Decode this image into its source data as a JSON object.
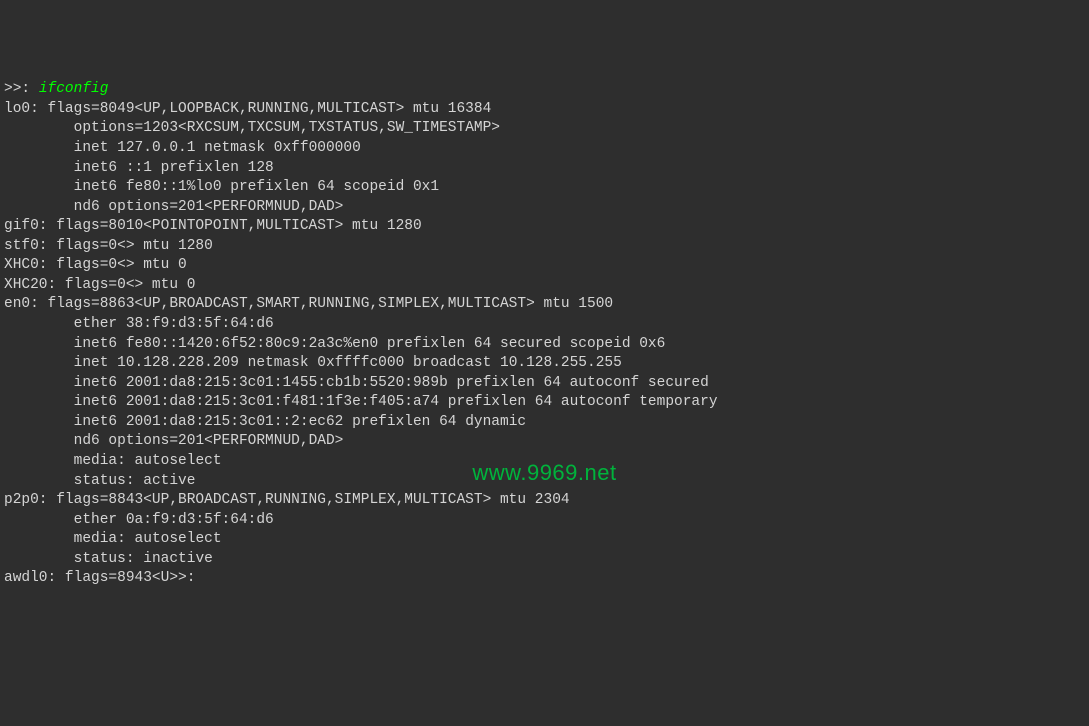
{
  "prompt": ">>: ",
  "command": "ifconfig",
  "lines": [
    "lo0: flags=8049<UP,LOOPBACK,RUNNING,MULTICAST> mtu 16384",
    "\toptions=1203<RXCSUM,TXCSUM,TXSTATUS,SW_TIMESTAMP>",
    "\tinet 127.0.0.1 netmask 0xff000000",
    "\tinet6 ::1 prefixlen 128",
    "\tinet6 fe80::1%lo0 prefixlen 64 scopeid 0x1",
    "\tnd6 options=201<PERFORMNUD,DAD>",
    "gif0: flags=8010<POINTOPOINT,MULTICAST> mtu 1280",
    "stf0: flags=0<> mtu 1280",
    "XHC0: flags=0<> mtu 0",
    "XHC20: flags=0<> mtu 0",
    "en0: flags=8863<UP,BROADCAST,SMART,RUNNING,SIMPLEX,MULTICAST> mtu 1500",
    "\tether 38:f9:d3:5f:64:d6",
    "\tinet6 fe80::1420:6f52:80c9:2a3c%en0 prefixlen 64 secured scopeid 0x6",
    "\tinet 10.128.228.209 netmask 0xffffc000 broadcast 10.128.255.255",
    "\tinet6 2001:da8:215:3c01:1455:cb1b:5520:989b prefixlen 64 autoconf secured",
    "\tinet6 2001:da8:215:3c01:f481:1f3e:f405:a74 prefixlen 64 autoconf temporary",
    "\tinet6 2001:da8:215:3c01::2:ec62 prefixlen 64 dynamic",
    "\tnd6 options=201<PERFORMNUD,DAD>",
    "\tmedia: autoselect",
    "\tstatus: active",
    "p2p0: flags=8843<UP,BROADCAST,RUNNING,SIMPLEX,MULTICAST> mtu 2304",
    "\tether 0a:f9:d3:5f:64:d6",
    "\tmedia: autoselect",
    "\tstatus: inactive",
    "awdl0: flags=8943<U>>:"
  ],
  "watermark": "www.9969.net"
}
